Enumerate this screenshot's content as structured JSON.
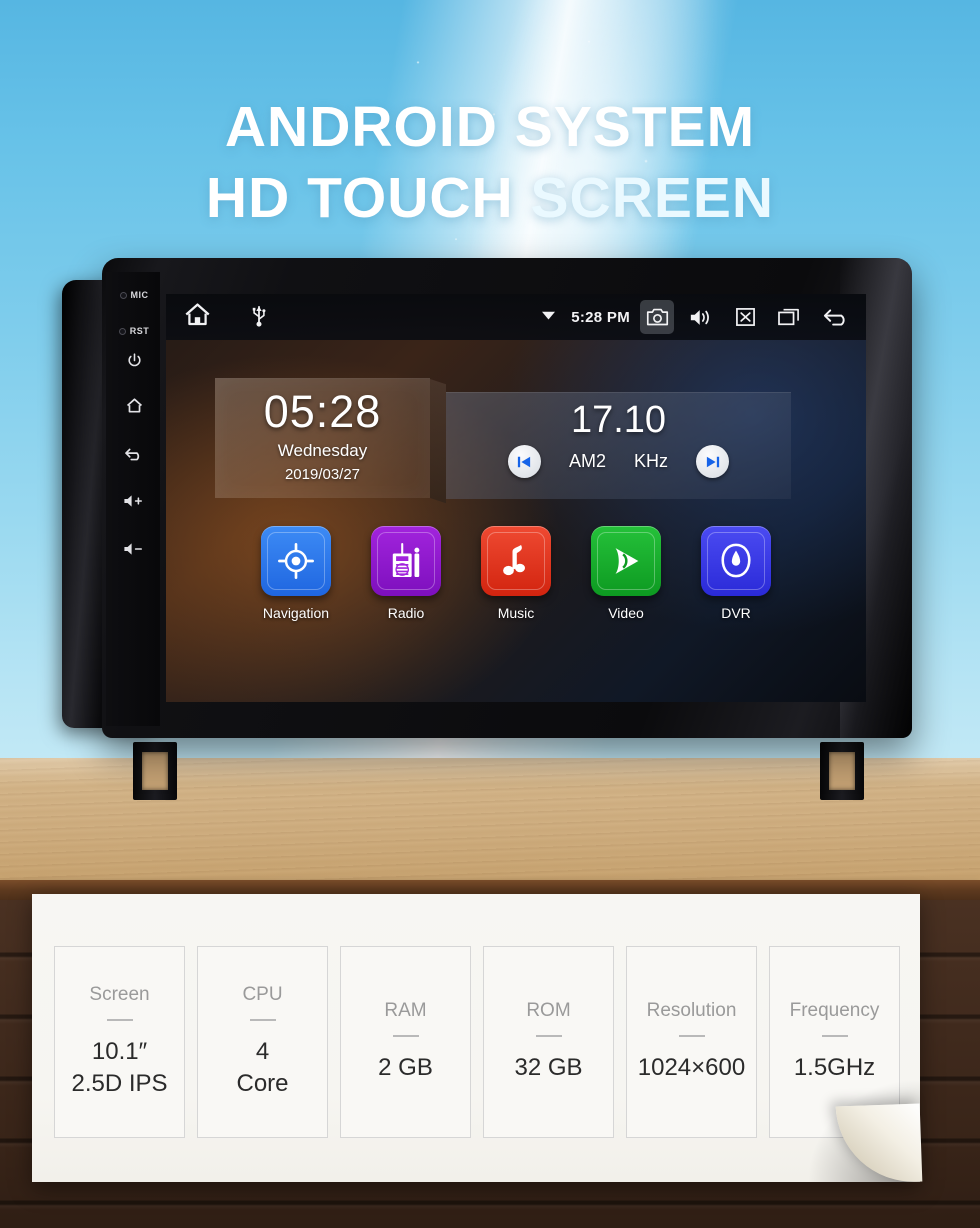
{
  "headline": {
    "line1": "ANDROID SYSTEM",
    "line2_part1": "HD TOUCH ",
    "line2_part2": "SCREEN"
  },
  "device": {
    "side_buttons": [
      {
        "name": "mic-indicator",
        "label": "MIC",
        "type": "led"
      },
      {
        "name": "reset-indicator",
        "label": "RST",
        "type": "led"
      },
      {
        "name": "power-button",
        "label": "",
        "type": "power"
      },
      {
        "name": "home-button",
        "label": "",
        "type": "home"
      },
      {
        "name": "back-button",
        "label": "",
        "type": "back"
      },
      {
        "name": "volume-up-button",
        "label": "",
        "type": "volup"
      },
      {
        "name": "volume-down-button",
        "label": "",
        "type": "voldown"
      }
    ],
    "statusbar": {
      "home_icon": "home-icon",
      "usb_icon": "usb-icon",
      "wifi_icon": "wifi-icon",
      "time": "5:28 PM",
      "camera_icon": "camera-icon",
      "volume_icon": "volume-icon",
      "close_icon": "close-box-icon",
      "recents_icon": "recent-apps-icon",
      "back_icon": "back-arrow-icon"
    },
    "clock_widget": {
      "time": "05:28",
      "weekday": "Wednesday",
      "date": "2019/03/27"
    },
    "radio_widget": {
      "frequency": "17.10",
      "band": "AM2",
      "unit": "KHz",
      "prev_icon": "skip-previous-icon",
      "next_icon": "skip-next-icon"
    },
    "apps": [
      {
        "label": "Navigation",
        "icon": "navigation-target-icon",
        "color": "#2878f0",
        "inner": "#2f7ff5"
      },
      {
        "label": "Radio",
        "icon": "radio-receiver-icon",
        "color": "#8b17c9",
        "inner": "#9420d6"
      },
      {
        "label": "Music",
        "icon": "music-note-icon",
        "color": "#e2331f",
        "inner": "#e8402c"
      },
      {
        "label": "Video",
        "icon": "video-play-icon",
        "color": "#16a92b",
        "inner": "#1cb832"
      },
      {
        "label": "DVR",
        "icon": "dvr-gauge-icon",
        "color": "#3535e6",
        "inner": "#4040ef"
      }
    ]
  },
  "specs": [
    {
      "title": "Screen",
      "value": "10.1″\n2.5D IPS"
    },
    {
      "title": "CPU",
      "value": "4\nCore"
    },
    {
      "title": "RAM",
      "value": "2 GB"
    },
    {
      "title": "ROM",
      "value": "32 GB"
    },
    {
      "title": "Resolution",
      "value": "1024×600"
    },
    {
      "title": "Frequency",
      "value": "1.5GHz"
    }
  ],
  "colors": {
    "sky": "#7fcdec",
    "headline": "#ffffff",
    "panel_bg": "#f7f6f3",
    "wood_top": "#d3b488",
    "wood_wall": "#402a1d"
  }
}
